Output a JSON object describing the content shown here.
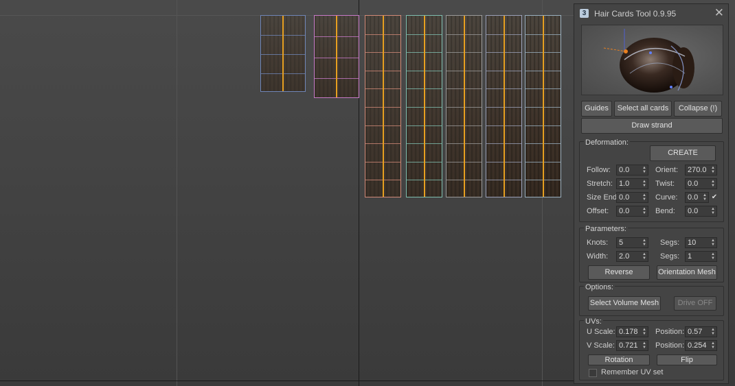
{
  "window": {
    "title": "Hair Cards Tool 0.9.95",
    "close": "✕",
    "icon": "3"
  },
  "cards": [
    {
      "color": "#6f86b8"
    },
    {
      "color": "#c87ac8"
    },
    {
      "color": "#d28a78"
    },
    {
      "color": "#7fbfb0"
    },
    {
      "color": "#9a9a9a"
    },
    {
      "color": "#9aa0b8"
    },
    {
      "color": "#9ab0c0"
    }
  ],
  "top_buttons": {
    "guides": "Guides",
    "select_all": "Select all cards",
    "collapse": "Collapse (!)",
    "draw_strand": "Draw strand"
  },
  "deformation": {
    "label": "Deformation:",
    "create": "CREATE",
    "follow_label": "Follow:",
    "follow": "0.0",
    "orient_label": "Orient:",
    "orient": "270.0",
    "stretch_label": "Stretch:",
    "stretch": "1.0",
    "twist_label": "Twist:",
    "twist": "0.0",
    "size_end_label": "Size End",
    "size_end": "0.0",
    "curve_label": "Curve:",
    "curve": "0.0",
    "curve_check": "✔",
    "offset_label": "Offset:",
    "offset": "0.0",
    "bend_label": "Bend:",
    "bend": "0.0"
  },
  "parameters": {
    "label": "Parameters:",
    "knots_label": "Knots:",
    "knots": "5",
    "segs1_label": "Segs:",
    "segs1": "10",
    "width_label": "Width:",
    "width": "2.0",
    "segs2_label": "Segs:",
    "segs2": "1",
    "reverse": "Reverse",
    "orientation_mesh": "Orientation Mesh"
  },
  "options": {
    "label": "Options:",
    "select_volume_mesh": "Select Volume Mesh",
    "drive": "Drive OFF"
  },
  "uvs": {
    "label": "UVs:",
    "u_scale_label": "U Scale:",
    "u_scale": "0.178",
    "u_pos_label": "Position:",
    "u_pos": "0.57",
    "v_scale_label": "V Scale:",
    "v_scale": "0.721",
    "v_pos_label": "Position:",
    "v_pos": "0.254",
    "rotation": "Rotation",
    "flip": "Flip",
    "remember_label": "Remember UV set"
  }
}
